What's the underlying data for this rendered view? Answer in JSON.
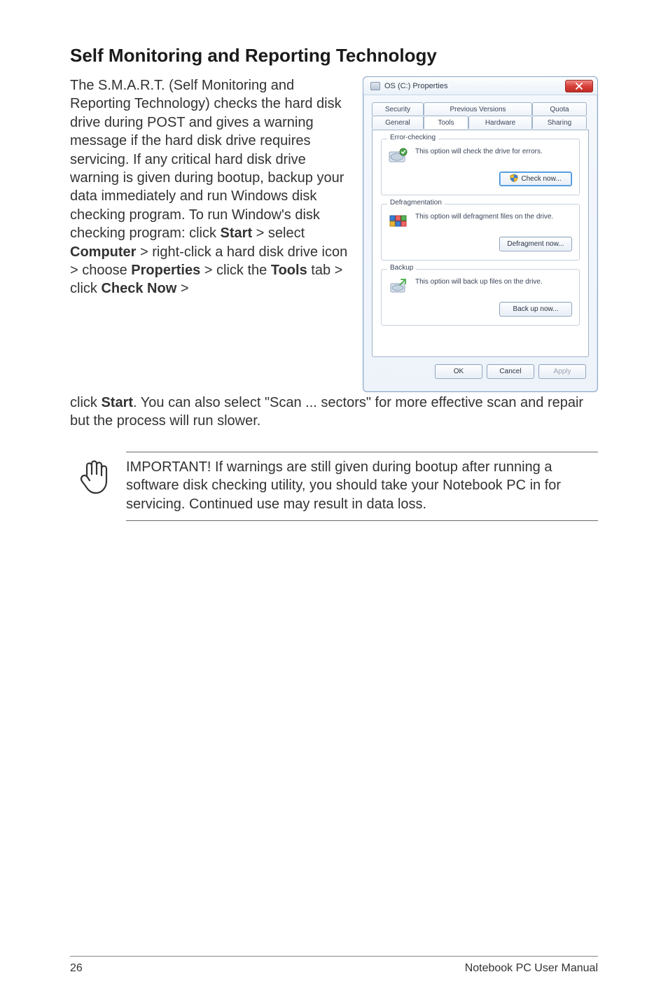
{
  "heading": "Self Monitoring and Reporting Technology",
  "para1_a": "The S.M.A.R.T. (Self Monitoring and Reporting Technology) checks the hard disk drive during POST and gives a warning message if the hard disk drive requires servicing. If any critical hard disk drive warning is given during bootup, backup your data immediately and run Windows disk checking program. To run Window's disk checking program: click ",
  "b_start": "Start",
  "para1_b": " > select ",
  "b_computer": "Computer",
  "para1_c": " > right-click a hard disk drive icon > choose ",
  "b_properties": "Properties",
  "para1_d": " > click the ",
  "b_tools": "Tools",
  "para1_e": " tab > click ",
  "b_checknow": "Check Now",
  "para1_f": " > ",
  "cont_a": "click ",
  "b_start2": "Start",
  "cont_b": ". You can also select \"Scan ... sectors\" for more effective scan and repair but the process will run slower.",
  "note": "IMPORTANT! If warnings are still given during bootup after running a software disk checking utility, you should take your Notebook PC in for servicing. Continued use may result in data loss.",
  "footer": {
    "page": "26",
    "title": "Notebook PC User Manual"
  },
  "dialog": {
    "title": "OS (C:) Properties",
    "tabs": {
      "security": "Security",
      "previous": "Previous Versions",
      "quota": "Quota",
      "general": "General",
      "tools": "Tools",
      "hardware": "Hardware",
      "sharing": "Sharing"
    },
    "groups": {
      "error": {
        "label": "Error-checking",
        "desc": "This option will check the drive for errors.",
        "btn": "Check now..."
      },
      "defrag": {
        "label": "Defragmentation",
        "desc": "This option will defragment files on the drive.",
        "btn": "Defragment now..."
      },
      "backup": {
        "label": "Backup",
        "desc": "This option will back up files on the drive.",
        "btn": "Back up now..."
      }
    },
    "buttons": {
      "ok": "OK",
      "cancel": "Cancel",
      "apply": "Apply"
    }
  }
}
